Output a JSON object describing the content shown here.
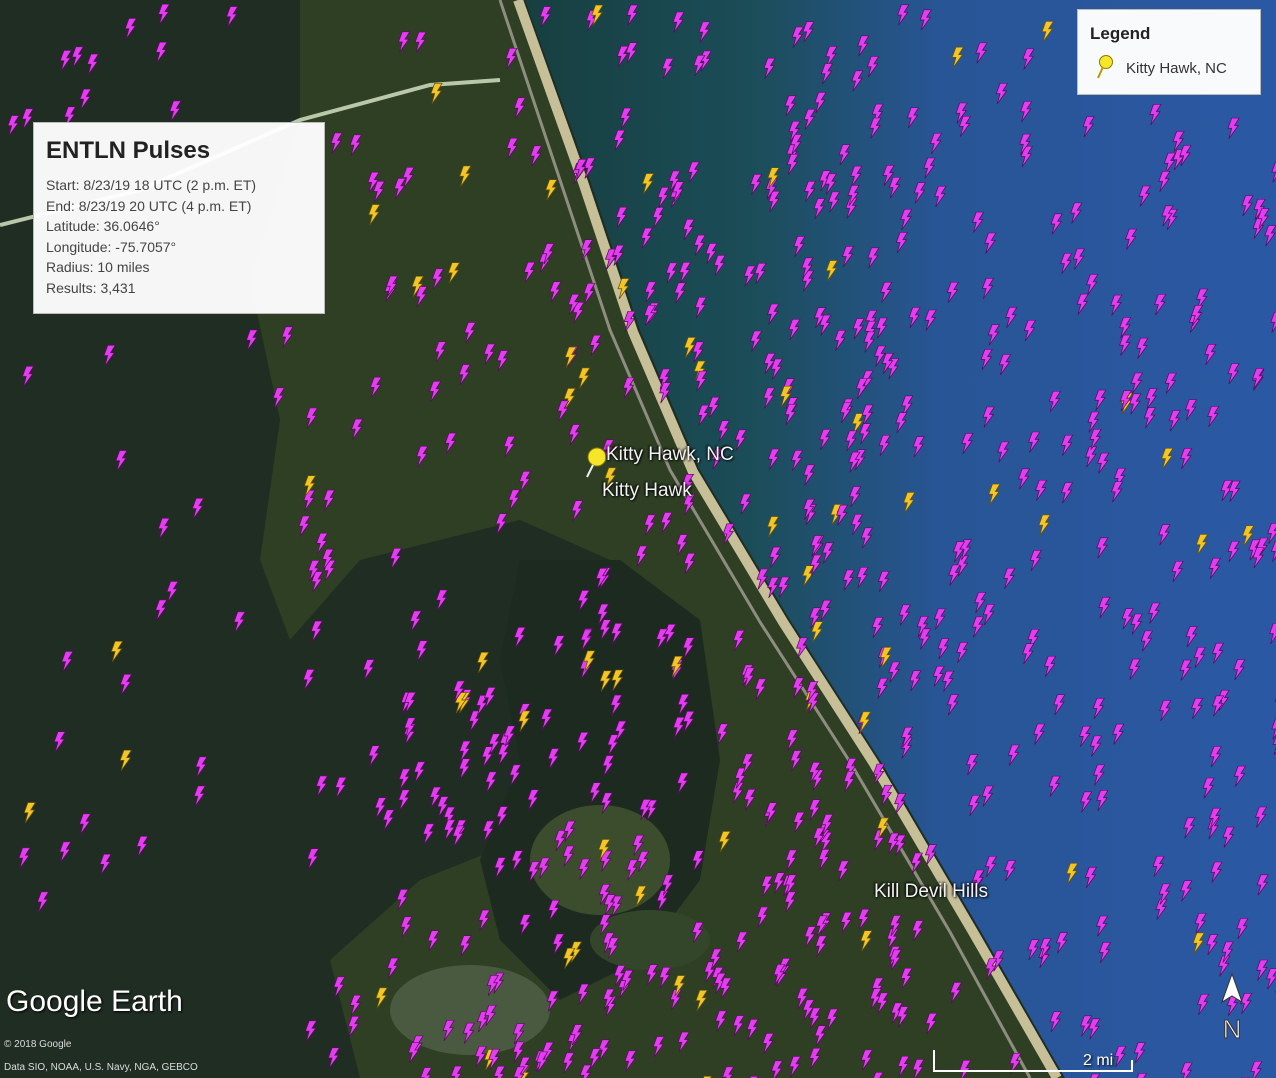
{
  "map": {
    "colors": {
      "sound_water": "#1f2d22",
      "land": "#2c3d22",
      "beach": "#c7bf98",
      "ocean_near": "#1b4d52",
      "ocean_far": "#2a55a0",
      "pulse_magenta": "#e43cf0",
      "pulse_yellow": "#f3c626"
    }
  },
  "info_panel": {
    "title": "ENTLN Pulses",
    "start": "Start: 8/23/19 18 UTC (2 p.m. ET)",
    "end": "End: 8/23/19 20 UTC (4 p.m. ET)",
    "latitude": "Latitude: 36.0646°",
    "longitude": "Longitude: -75.7057°",
    "radius": "Radius: 10 miles",
    "results": "Results: 3,431"
  },
  "legend": {
    "title": "Legend",
    "item_label": "Kitty Hawk, NC",
    "item_icon": "yellow-pushpin-icon"
  },
  "place_labels": {
    "marker_label": "Kitty Hawk, NC",
    "town_kitty_hawk": "Kitty Hawk",
    "town_kill_devil_hills": "Kill Devil Hills"
  },
  "watermark": "Google Earth",
  "copyright": "© 2018 Google",
  "data_credit": "Data SIO, NOAA, U.S. Navy, NGA, GEBCO",
  "scale": {
    "label": "2 mi"
  },
  "compass": {
    "label": "N",
    "icon": "north-arrow-icon"
  },
  "pulse_icon": "lightning-bolt-icon"
}
